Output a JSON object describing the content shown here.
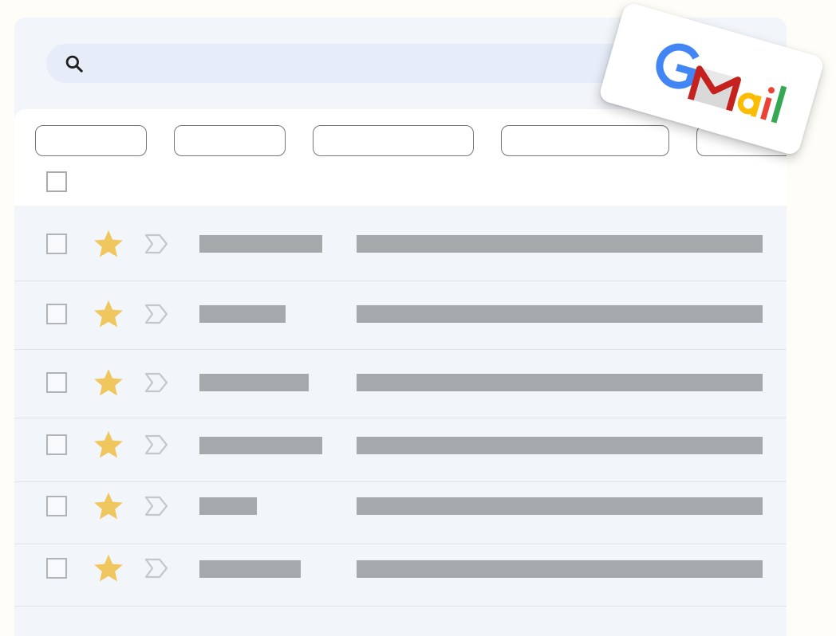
{
  "search": {
    "icon": "search-icon"
  },
  "filter_chips": [
    {
      "label": ""
    },
    {
      "label": ""
    },
    {
      "label": ""
    },
    {
      "label": ""
    },
    {
      "label": ""
    }
  ],
  "email_rows": [
    {
      "starred": true,
      "sender": "",
      "subject": ""
    },
    {
      "starred": true,
      "sender": "",
      "subject": ""
    },
    {
      "starred": true,
      "sender": "",
      "subject": ""
    },
    {
      "starred": true,
      "sender": "",
      "subject": ""
    },
    {
      "starred": true,
      "sender": "",
      "subject": ""
    },
    {
      "starred": true,
      "sender": "",
      "subject": ""
    }
  ],
  "logo": {
    "text": "Gmail",
    "colors": {
      "blue": "#4285f4",
      "red": "#ea4335",
      "yellow": "#fbbc04",
      "green": "#34a853",
      "dark_red": "#c5221f"
    }
  },
  "colors": {
    "page_background": "#fefdf8",
    "app_background": "#f2f5fa",
    "search_background": "#e6edf9",
    "star": "#f0c75e",
    "placeholder_bar": "#a6a9ac",
    "chip_border": "#747775"
  }
}
